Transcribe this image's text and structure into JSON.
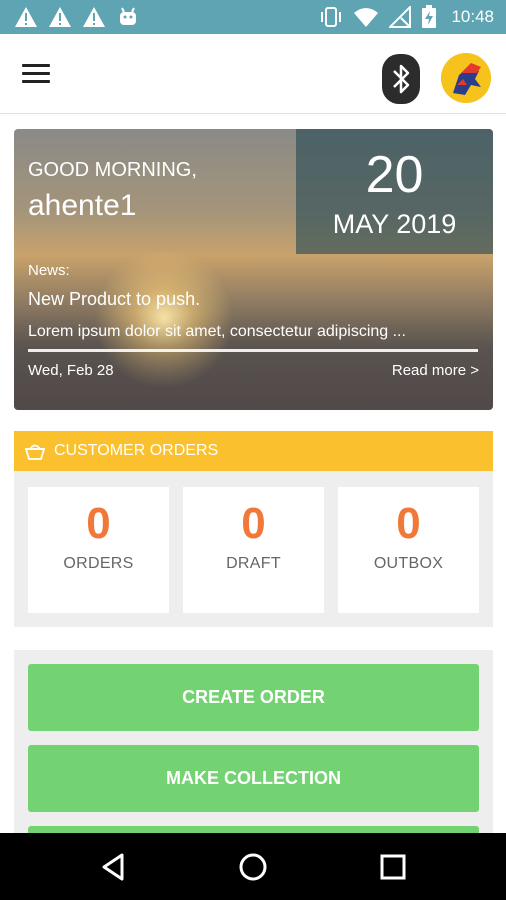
{
  "status_bar": {
    "time": "10:48",
    "left_icons": [
      "warning-icon",
      "warning-icon",
      "warning-icon",
      "android-icon"
    ],
    "right_icons": [
      "vibrate-icon",
      "wifi-icon",
      "no-signal-icon",
      "battery-charging-icon"
    ]
  },
  "toolbar": {
    "menu_icon": "hamburger-icon",
    "bluetooth_icon": "bluetooth-icon",
    "avatar_icon": "avatar"
  },
  "hero": {
    "greeting": "GOOD MORNING,",
    "username": "ahente1",
    "day": "20",
    "month_year": "MAY 2019",
    "news_label": "News:",
    "news_title": "New Product to push.",
    "news_body": "Lorem ipsum dolor sit amet, consectetur adipiscing ...",
    "news_date": "Wed, Feb 28",
    "read_more": "Read more >"
  },
  "orders": {
    "header": "CUSTOMER ORDERS",
    "header_icon": "basket-icon",
    "stats": [
      {
        "value": "0",
        "label": "ORDERS"
      },
      {
        "value": "0",
        "label": "DRAFT"
      },
      {
        "value": "0",
        "label": "OUTBOX"
      }
    ]
  },
  "actions": {
    "buttons": [
      "CREATE ORDER",
      "MAKE COLLECTION"
    ]
  },
  "colors": {
    "status_bar": "#5fa4b2",
    "orders_header": "#fbc02d",
    "stat_value": "#f0793a",
    "action_button": "#73d271"
  }
}
